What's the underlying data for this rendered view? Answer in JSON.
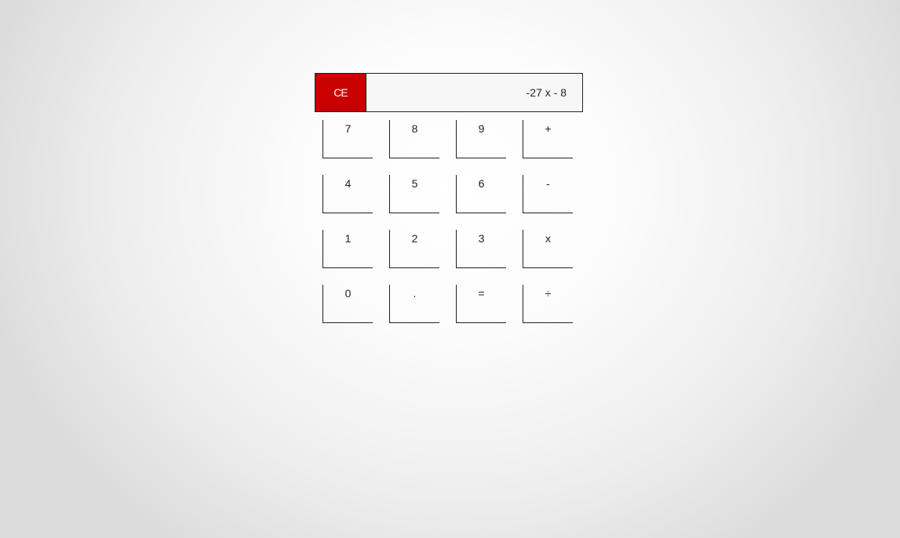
{
  "calculator": {
    "clear_label": "CE",
    "display_value": "-27 x - 8",
    "clear_color": "#c80000",
    "keys": [
      "7",
      "8",
      "9",
      "+",
      "4",
      "5",
      "6",
      "-",
      "1",
      "2",
      "3",
      "x",
      "0",
      ".",
      "=",
      "÷"
    ]
  }
}
